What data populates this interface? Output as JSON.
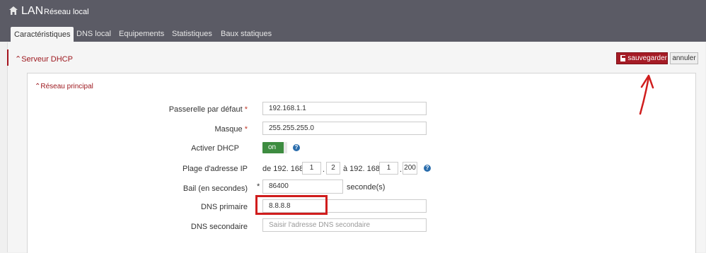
{
  "header": {
    "app_name": "LAN",
    "subtitle": "Réseau local",
    "icon": "home-icon"
  },
  "tabs": [
    {
      "label": "Caractéristiques",
      "active": true
    },
    {
      "label": "DNS local",
      "active": false
    },
    {
      "label": "Equipements",
      "active": false
    },
    {
      "label": "Statistiques",
      "active": false
    },
    {
      "label": "Baux statiques",
      "active": false
    }
  ],
  "section": {
    "title": "Serveur DHCP"
  },
  "actions": {
    "save_label": "sauvegarder",
    "cancel_label": "annuler"
  },
  "subsection": {
    "title": "Réseau principal"
  },
  "form": {
    "gateway": {
      "label": "Passerelle par défaut",
      "required": "*",
      "value": "192.168.1.1"
    },
    "mask": {
      "label": "Masque",
      "required": "*",
      "value": "255.255.255.0"
    },
    "dhcp": {
      "label": "Activer DHCP",
      "toggle": "on"
    },
    "range": {
      "label": "Plage d'adresse IP",
      "from_prefix": "de 192. 168.",
      "from_oct3": "1",
      "from_oct4": "2",
      "to_prefix": "à 192. 168.",
      "to_oct3": "1",
      "to_oct4": "200"
    },
    "lease": {
      "label": "Bail (en secondes)",
      "required": "*",
      "value": "86400",
      "unit": "seconde(s)"
    },
    "dns1": {
      "label": "DNS primaire",
      "value": "8.8.8.8"
    },
    "dns2": {
      "label": "DNS secondaire",
      "placeholder": "Saisir l'adresse DNS secondaire"
    }
  },
  "colors": {
    "accent": "#a51b25",
    "toggle_on": "#3d8c40",
    "annotation": "#d01d1d"
  }
}
